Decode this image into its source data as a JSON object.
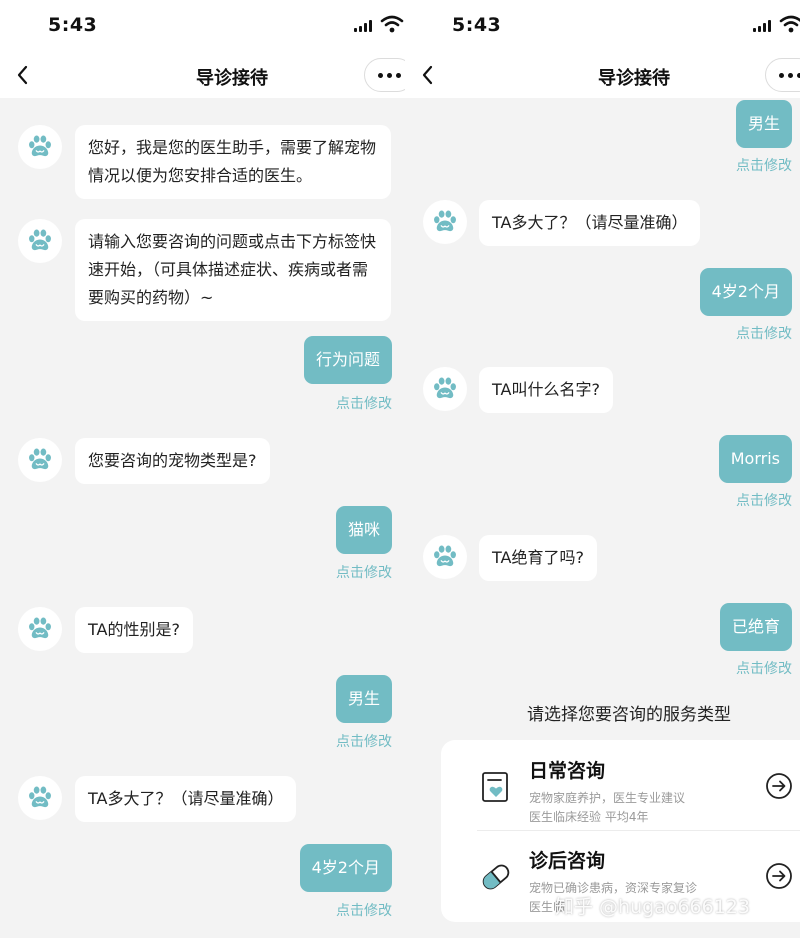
{
  "status": {
    "time": "5:43"
  },
  "nav": {
    "title": "导诊接待"
  },
  "left_chat": {
    "bot1": "您好，我是您的医生助手，需要了解宠物情况以便为您安排合适的医生。",
    "bot2": "请输入您要咨询的问题或点击下方标签快速开始，（可具体描述症状、疾病或者需要购买的药物）~",
    "user1": "行为问题",
    "bot3": "您要咨询的宠物类型是?",
    "user2": "猫咪",
    "bot4": "TA的性别是?",
    "user3": "男生",
    "bot5": "TA多大了？（请尽量准确）",
    "user4": "4岁2个月",
    "modify": "点击修改"
  },
  "right_chat": {
    "user1": "男生",
    "bot1": "TA多大了？（请尽量准确）",
    "user2": "4岁2个月",
    "bot2": "TA叫什么名字?",
    "user3": "Morris",
    "bot3": "TA绝育了吗?",
    "user4": "已绝育",
    "modify": "点击修改"
  },
  "services": {
    "prompt": "请选择您要咨询的服务类型",
    "items": [
      {
        "name": "日常咨询",
        "desc1": "宠物家庭养护，医生专业建议",
        "desc2": "医生临床经验 平均4年",
        "icon": "clipboard-heart-icon"
      },
      {
        "name": "诊后咨询",
        "desc1": "宠物已确诊患病，资深专家复诊",
        "desc2": "医生临",
        "icon": "pill-capsule-icon"
      }
    ]
  },
  "watermark": "知乎 @hugao666123",
  "colors": {
    "accent": "#72bcc4",
    "background": "#f3f3f3",
    "bubble": "#ffffff",
    "hint": "#9a9a9a"
  }
}
